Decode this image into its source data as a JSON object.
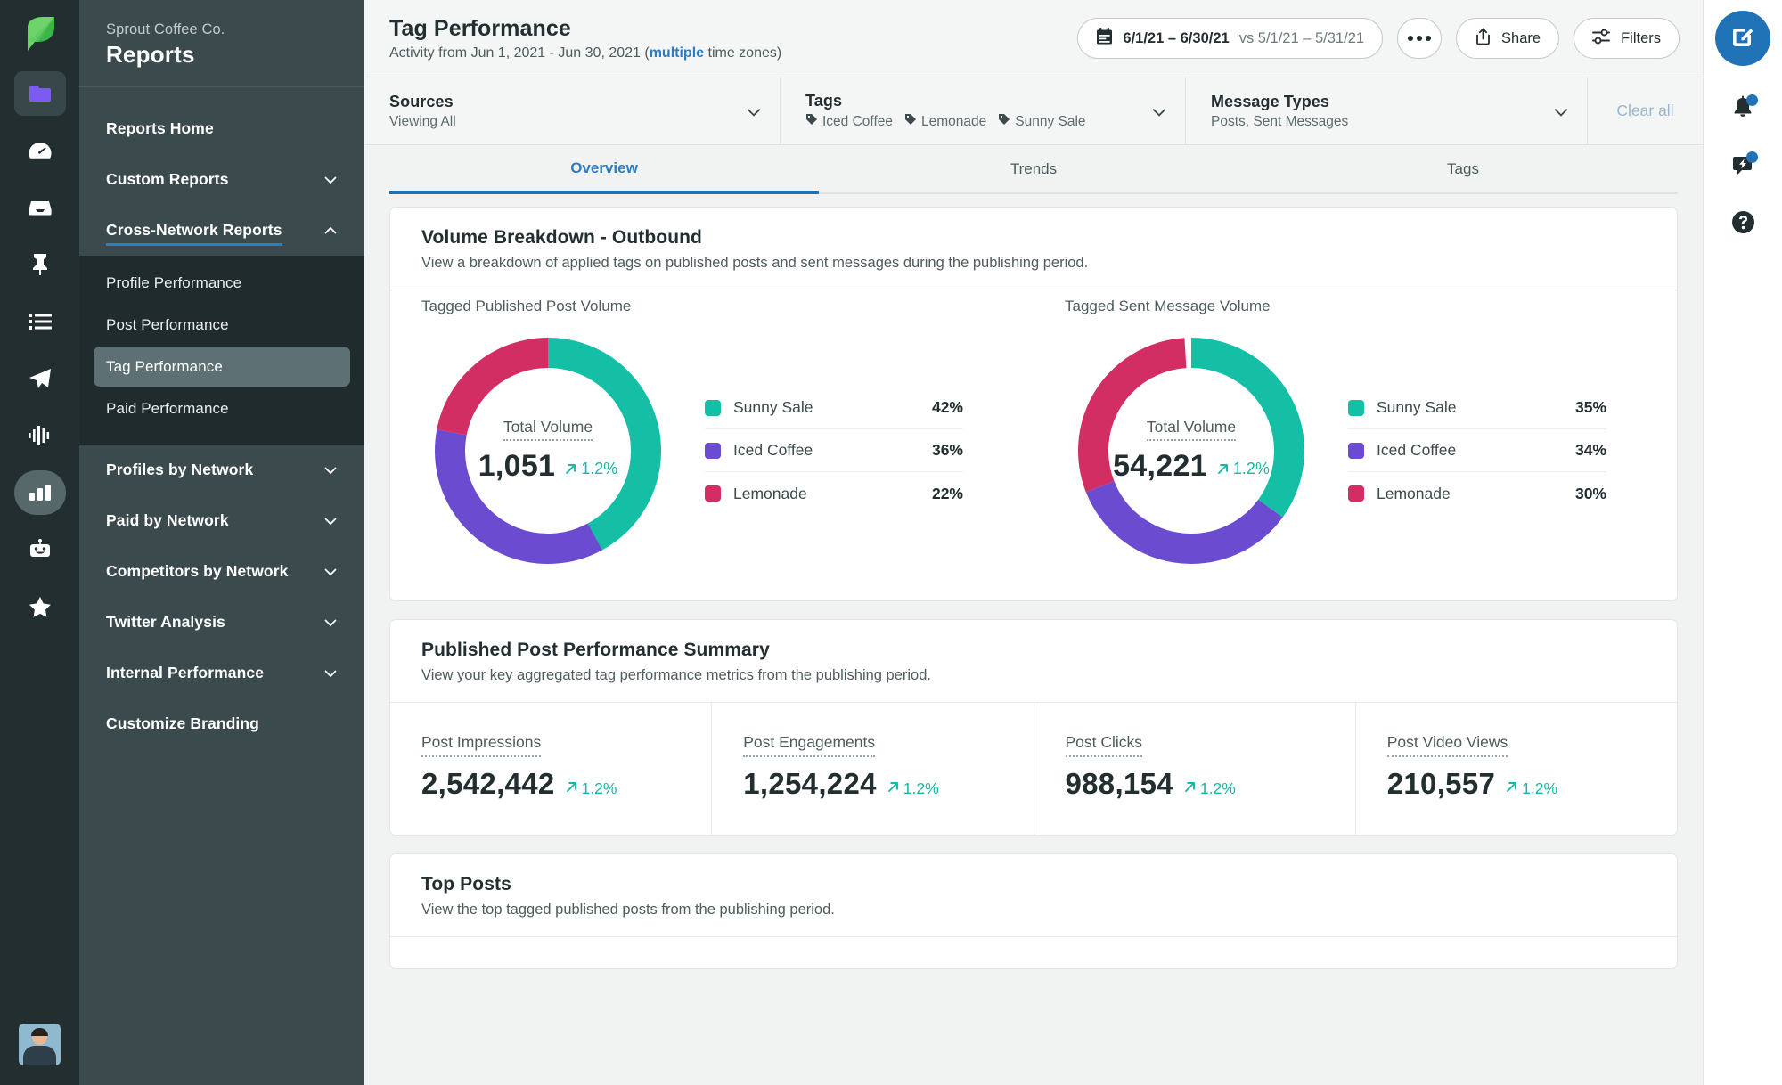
{
  "rail": {
    "logo": "sprout-leaf-logo",
    "items": [
      {
        "icon": "folder-icon",
        "name": "rail-item-publishing",
        "state": "boxed"
      },
      {
        "icon": "dashboard-speedometer-icon",
        "name": "rail-item-dashboard",
        "state": "plain"
      },
      {
        "icon": "inbox-icon",
        "name": "rail-item-inbox",
        "state": "plain"
      },
      {
        "icon": "pin-icon",
        "name": "rail-item-pinned",
        "state": "plain"
      },
      {
        "icon": "list-icon",
        "name": "rail-item-tasks",
        "state": "plain"
      },
      {
        "icon": "paper-plane-icon",
        "name": "rail-item-send",
        "state": "plain"
      },
      {
        "icon": "listening-waveform-icon",
        "name": "rail-item-listening",
        "state": "plain"
      },
      {
        "icon": "bar-chart-icon",
        "name": "rail-item-reports",
        "state": "pill"
      },
      {
        "icon": "bot-icon",
        "name": "rail-item-bots",
        "state": "plain"
      },
      {
        "icon": "star-icon",
        "name": "rail-item-reviews",
        "state": "plain"
      }
    ],
    "avatar": "user-avatar"
  },
  "sidebar": {
    "org": "Sprout Coffee Co.",
    "title": "Reports",
    "nav": [
      {
        "label": "Reports Home",
        "expandable": false,
        "underline": false
      },
      {
        "label": "Custom Reports",
        "expandable": true,
        "chevron": "chevron-down",
        "underline": false
      },
      {
        "label": "Cross-Network Reports",
        "expandable": true,
        "chevron": "chevron-up",
        "underline": true
      }
    ],
    "sub_items": [
      {
        "label": "Profile Performance",
        "selected": false
      },
      {
        "label": "Post Performance",
        "selected": false
      },
      {
        "label": "Tag Performance",
        "selected": true
      },
      {
        "label": "Paid Performance",
        "selected": false
      }
    ],
    "nav_bottom": [
      {
        "label": "Profiles by Network",
        "expandable": true,
        "chevron": "chevron-down"
      },
      {
        "label": "Paid by Network",
        "expandable": true,
        "chevron": "chevron-down"
      },
      {
        "label": "Competitors by Network",
        "expandable": true,
        "chevron": "chevron-down"
      },
      {
        "label": "Twitter Analysis",
        "expandable": true,
        "chevron": "chevron-down"
      },
      {
        "label": "Internal Performance",
        "expandable": true,
        "chevron": "chevron-down"
      },
      {
        "label": "Customize Branding",
        "expandable": false
      }
    ]
  },
  "header": {
    "title": "Tag Performance",
    "subtitle_pre": "Activity from Jun 1, 2021 - Jun 30, 2021 (",
    "subtitle_link": "multiple",
    "subtitle_post": " time zones)",
    "date_icon": "calendar-icon",
    "date_range": "6/1/21 – 6/30/21",
    "date_compare": "vs 5/1/21 – 5/31/21",
    "more_label": "more-options",
    "share_label": "Share",
    "share_icon": "share-upload-icon",
    "filters_label": "Filters",
    "filters_icon": "sliders-icon"
  },
  "filterbar": {
    "sources": {
      "label": "Sources",
      "value": "Viewing All",
      "chevron": "chevron-down"
    },
    "tags": {
      "label": "Tags",
      "chips": [
        "Iced Coffee",
        "Lemonade",
        "Sunny Sale"
      ],
      "chip_icon": "tag-icon",
      "chevron": "chevron-down"
    },
    "message_types": {
      "label": "Message Types",
      "value": "Posts, Sent Messages",
      "chevron": "chevron-down"
    },
    "clear_all": "Clear all"
  },
  "tabs": [
    {
      "label": "Overview",
      "active": true
    },
    {
      "label": "Trends",
      "active": false
    },
    {
      "label": "Tags",
      "active": false
    }
  ],
  "volume_card": {
    "title": "Volume Breakdown - Outbound",
    "description": "View a breakdown of applied tags on published posts and sent messages during the publishing period."
  },
  "summary_card": {
    "title": "Published Post Performance Summary",
    "description": "View your key aggregated tag performance metrics from the publishing period.",
    "metrics": [
      {
        "label": "Post Impressions",
        "value": "2,542,442",
        "delta": "1.2%",
        "trend": "up"
      },
      {
        "label": "Post Engagements",
        "value": "1,254,224",
        "delta": "1.2%",
        "trend": "up"
      },
      {
        "label": "Post Clicks",
        "value": "988,154",
        "delta": "1.2%",
        "trend": "up"
      },
      {
        "label": "Post Video Views",
        "value": "210,557",
        "delta": "1.2%",
        "trend": "up"
      }
    ]
  },
  "top_posts_card": {
    "title": "Top Posts",
    "description": "View the top tagged published posts from the publishing period."
  },
  "right_rail": {
    "compose": "compose-icon",
    "items": [
      {
        "icon": "bell-icon",
        "name": "notifications-button",
        "badge": true
      },
      {
        "icon": "feedback-bolt-icon",
        "name": "whats-new-button",
        "badge": true
      },
      {
        "icon": "help-question-icon",
        "name": "help-button",
        "badge": false
      }
    ]
  },
  "colors": {
    "teal": "#15bfa5",
    "purple": "#6b4cd0",
    "pink": "#d32e63",
    "accent_blue": "#2173b8",
    "delta_green": "#14b8a6"
  },
  "chart_data": [
    {
      "type": "pie",
      "variant": "donut",
      "title": "Tagged Published Post Volume",
      "center_label": "Total Volume",
      "center_value": "1,051",
      "center_delta": "1.2%",
      "center_trend": "up",
      "categories": [
        "Sunny Sale",
        "Iced Coffee",
        "Lemonade"
      ],
      "values": [
        42,
        36,
        22
      ],
      "value_labels": [
        "42%",
        "36%",
        "22%"
      ],
      "colors": [
        "#15bfa5",
        "#6b4cd0",
        "#d32e63"
      ],
      "legend_position": "right",
      "start_angle": 0,
      "direction": "clockwise"
    },
    {
      "type": "pie",
      "variant": "donut",
      "title": "Tagged Sent Message Volume",
      "center_label": "Total Volume",
      "center_value": "54,221",
      "center_delta": "1.2%",
      "center_trend": "up",
      "categories": [
        "Sunny Sale",
        "Iced Coffee",
        "Lemonade"
      ],
      "values": [
        35,
        34,
        30
      ],
      "value_labels": [
        "35%",
        "34%",
        "30%"
      ],
      "colors": [
        "#15bfa5",
        "#6b4cd0",
        "#d32e63"
      ],
      "legend_position": "right",
      "start_angle": 0,
      "direction": "clockwise"
    }
  ]
}
